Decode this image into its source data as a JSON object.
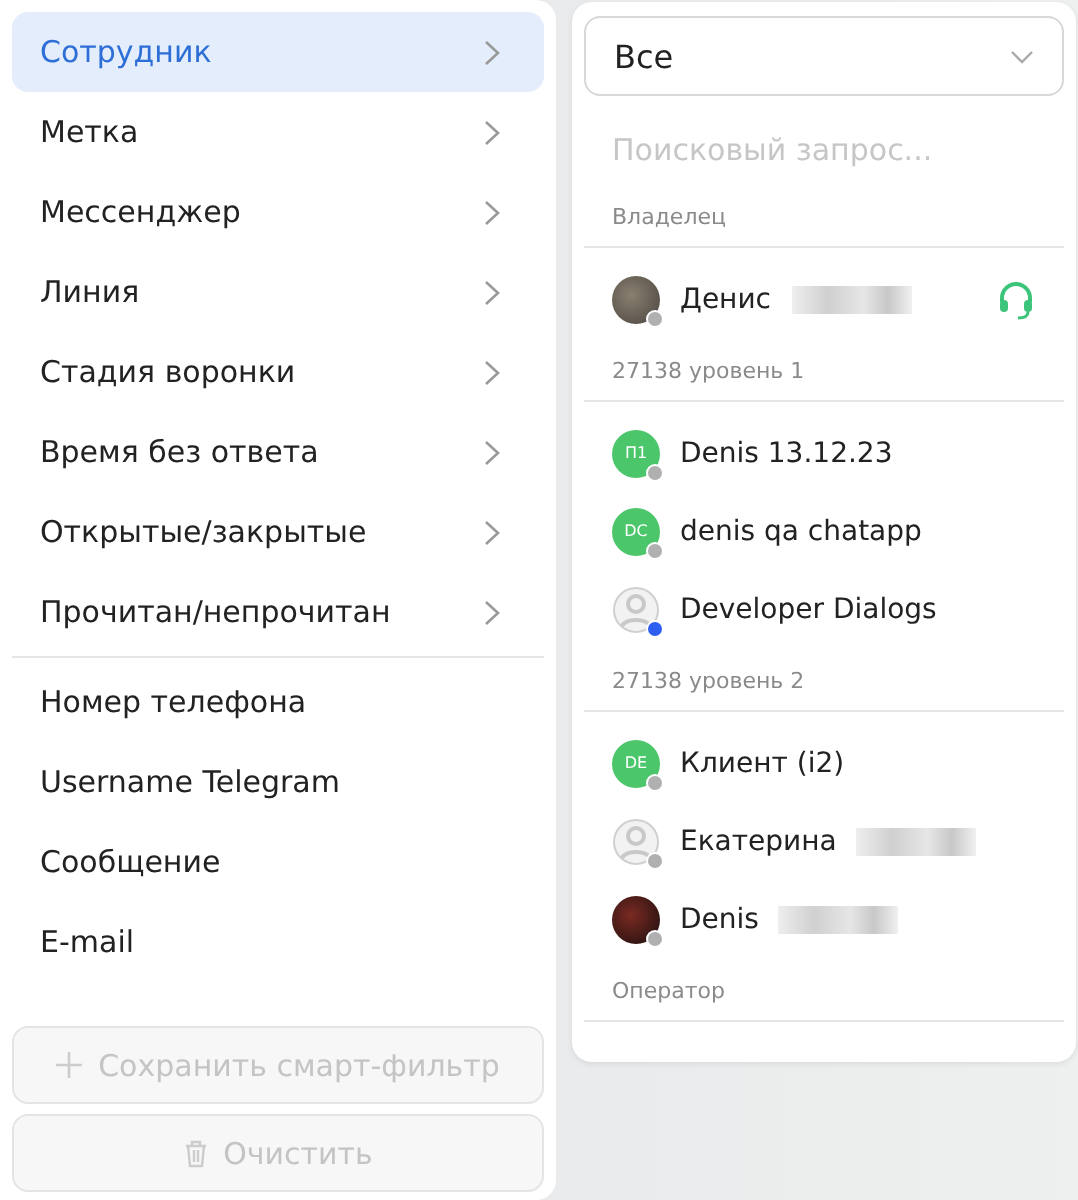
{
  "menu": {
    "submenus": [
      {
        "label": "Сотрудник",
        "selected": true
      },
      {
        "label": "Метка",
        "selected": false
      },
      {
        "label": "Мессенджер",
        "selected": false
      },
      {
        "label": "Линия",
        "selected": false
      },
      {
        "label": "Стадия воронки",
        "selected": false
      },
      {
        "label": "Время без ответа",
        "selected": false
      },
      {
        "label": "Открытые/закрытые",
        "selected": false
      },
      {
        "label": "Прочитан/непрочитан",
        "selected": false
      }
    ],
    "fields": [
      "Номер телефона",
      "Username Telegram",
      "Сообщение",
      "E-mail"
    ]
  },
  "actions": [
    {
      "label": "Сохранить смарт-фильтр",
      "kind": "plus",
      "disabled": true
    },
    {
      "label": "Очистить",
      "kind": "trash",
      "disabled": true
    }
  ],
  "dropdown": {
    "select": {
      "value": "Все"
    },
    "search": {
      "placeholder": "Поисковый запрос..."
    },
    "groups": [
      {
        "title": "Владелец",
        "people": [
          {
            "name": "Денис",
            "kind": "photo",
            "color": "#b0b0b0",
            "headset": true,
            "redacted": true
          }
        ]
      },
      {
        "title": "27138 уровень 1",
        "people": [
          {
            "name": "Denis 13.12.23",
            "kind": "initials",
            "initials": "П1",
            "color": "#b0b0b0",
            "headset": false,
            "redacted": false
          },
          {
            "name": "denis qa chatapp",
            "kind": "initials",
            "initials": "DC",
            "color": "#b0b0b0",
            "headset": false,
            "redacted": false
          },
          {
            "name": "Developer Dialogs",
            "kind": "silhouette",
            "color": "#2f5ff0",
            "headset": false,
            "redacted": false
          }
        ]
      },
      {
        "title": "27138 уровень 2",
        "people": [
          {
            "name": "Клиент (i2)",
            "kind": "initials",
            "initials": "DE",
            "color": "#b0b0b0",
            "headset": false,
            "redacted": false
          },
          {
            "name": "Екатерина",
            "kind": "silhouette",
            "color": "#b0b0b0",
            "headset": false,
            "redacted": true
          },
          {
            "name": "Denis",
            "kind": "photo-dark",
            "color": "#b0b0b0",
            "headset": false,
            "redacted": true
          }
        ]
      },
      {
        "title": "Оператор"
      }
    ]
  }
}
